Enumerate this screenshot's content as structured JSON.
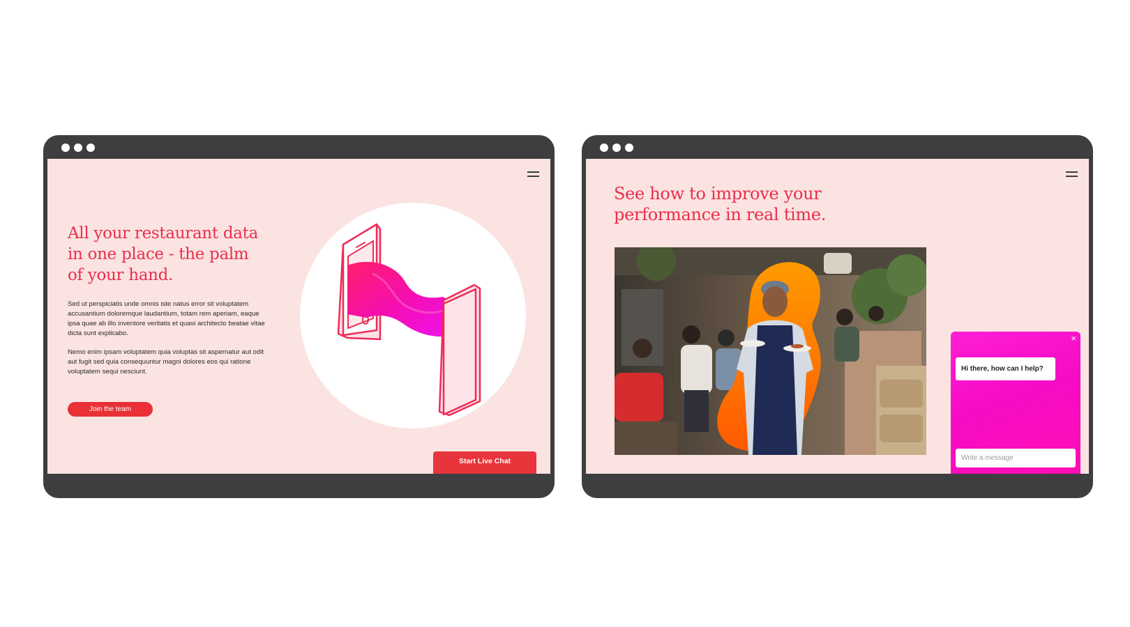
{
  "left_screen": {
    "headline": "All your restaurant data\nin one place - the palm\nof your hand.",
    "paragraph_1": "Sed ut perspiciatis unde omnis iste natus error sit voluptatem accusantium doloremque laudantium, totam rem aperiam, eaque ipsa quae ab illo inventore veritatis et quasi architecto beatae vitae dicta sunt explicabo.",
    "paragraph_2": "Nemo enim ipsam voluptatem quia voluptas sit aspernatur aut odit aut fugit sed quia consequuntur magni dolores eos qui ratione voluptatem sequi nesciunt.",
    "join_button": "Join the team",
    "chat_button": "Start Live Chat"
  },
  "right_screen": {
    "headline": "See how to improve your\nperformance in real time.",
    "chat": {
      "close_icon": "×",
      "greeting": "Hi there, how can I help?",
      "input_placeholder": "Write a message"
    }
  },
  "colors": {
    "accent_red": "#ea2e4c",
    "button_red": "#e8343b",
    "screen_bg": "#fbe3e1",
    "frame": "#3e3e40",
    "chat_magenta": "#f60cc6",
    "blob_orange": "#ff7a00"
  }
}
